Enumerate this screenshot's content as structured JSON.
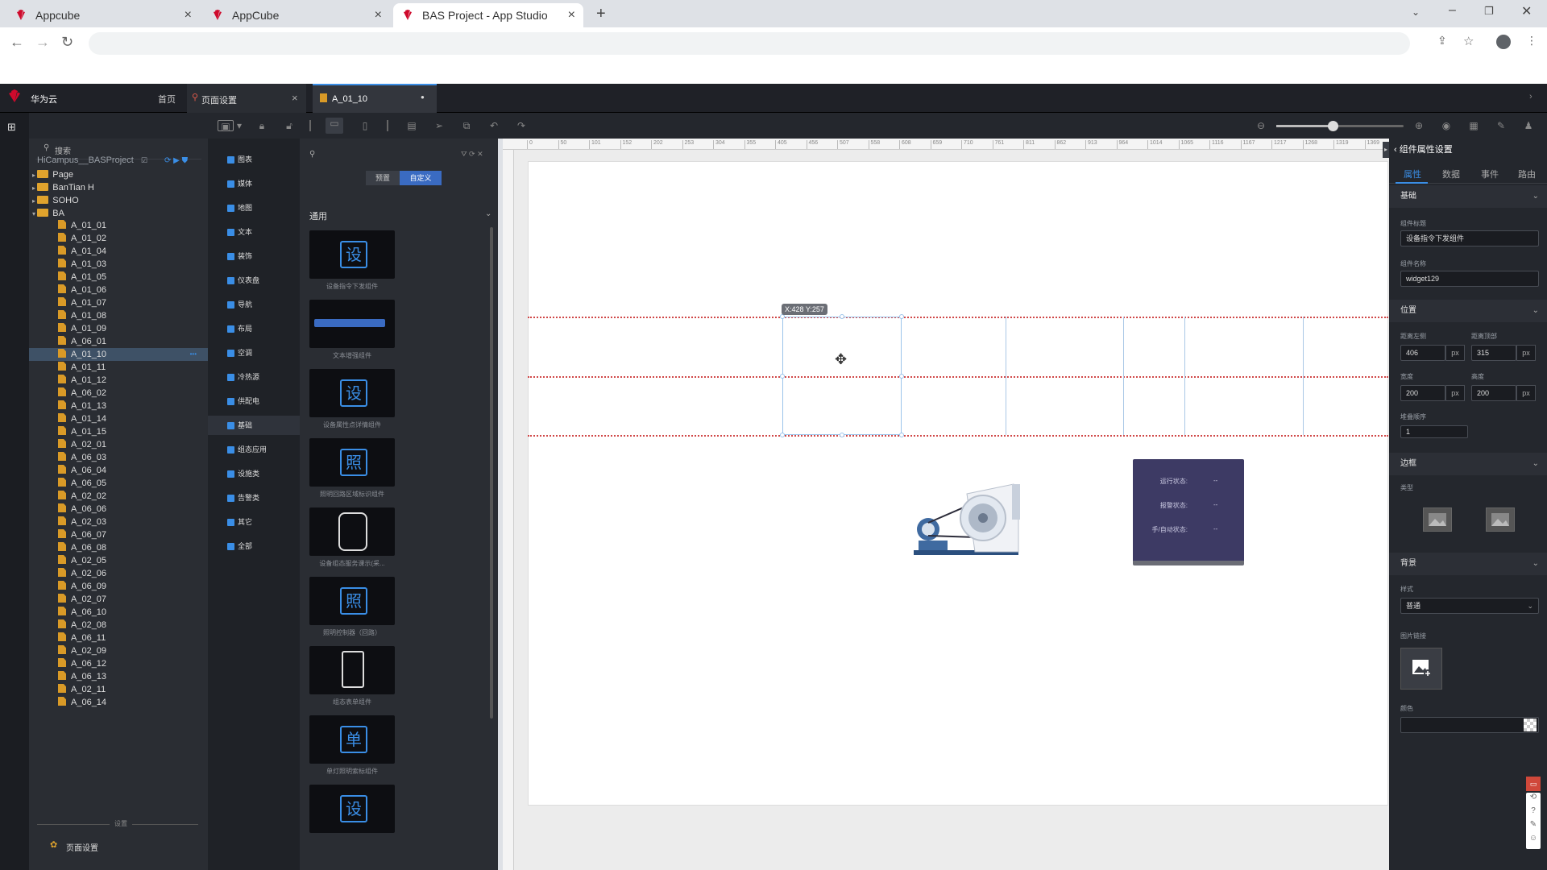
{
  "browser": {
    "tabs": [
      {
        "label": "Appcube",
        "close": "×"
      },
      {
        "label": "AppCube",
        "close": "×"
      },
      {
        "label": "BAS Project - App Studio",
        "close": "×"
      }
    ],
    "new_tab": "+"
  },
  "app": {
    "brand": "华为云",
    "home": "首页",
    "editor_tabs": [
      {
        "label": "页面设置",
        "close": "×"
      },
      {
        "label": "A_01_10",
        "close": "●"
      }
    ]
  },
  "tree": {
    "search_placeholder": "搜索",
    "project": "HiCampus__BASProject",
    "folders": [
      "Page",
      "BanTian H",
      "SOHO",
      "BA"
    ],
    "pages": [
      "A_01_01",
      "A_01_02",
      "A_01_04",
      "A_01_03",
      "A_01_05",
      "A_01_06",
      "A_01_07",
      "A_01_08",
      "A_01_09",
      "A_06_01",
      "A_01_10",
      "A_01_11",
      "A_01_12",
      "A_06_02",
      "A_01_13",
      "A_01_14",
      "A_01_15",
      "A_02_01",
      "A_06_03",
      "A_06_04",
      "A_06_05",
      "A_02_02",
      "A_06_06",
      "A_02_03",
      "A_06_07",
      "A_06_08",
      "A_02_05",
      "A_02_06",
      "A_06_09",
      "A_02_07",
      "A_06_10",
      "A_02_08",
      "A_06_11",
      "A_02_09",
      "A_06_12",
      "A_06_13",
      "A_02_11",
      "A_06_14"
    ],
    "selected": "A_01_10",
    "footer_divider": "设置",
    "footer_item": "页面设置"
  },
  "categories": {
    "items": [
      "图表",
      "媒体",
      "地图",
      "文本",
      "装饰",
      "仪表盘",
      "导航",
      "布局",
      "空调",
      "冷热源",
      "供配电",
      "基础",
      "组态应用",
      "设施类",
      "告警类",
      "其它",
      "全部"
    ],
    "selected": "基础"
  },
  "widgets": {
    "tabs": [
      "预置",
      "自定义"
    ],
    "active_tab": "自定义",
    "group": "通用",
    "items": [
      {
        "glyph": "设",
        "label": "设备指令下发组件"
      },
      {
        "glyph": "",
        "label": "文本增强组件"
      },
      {
        "glyph": "设",
        "label": "设备属性点详情组件"
      },
      {
        "glyph": "照",
        "label": "照明回路区域标识组件"
      },
      {
        "glyph": "",
        "label": "设备组态服务课示(采..."
      },
      {
        "glyph": "照",
        "label": "照明控制器（回路）"
      },
      {
        "glyph": "",
        "label": "组态表单组件"
      },
      {
        "glyph": "单",
        "label": "单灯照明索标组件"
      },
      {
        "glyph": "设",
        "label": ""
      }
    ]
  },
  "ruler": {
    "ticks": [
      "0",
      "50",
      "101",
      "152",
      "202",
      "253",
      "304",
      "355",
      "405",
      "456",
      "507",
      "558",
      "608",
      "659",
      "710",
      "761",
      "811",
      "862",
      "913",
      "964",
      "1014",
      "1065",
      "1116",
      "1167",
      "1217",
      "1268",
      "1319",
      "1369"
    ]
  },
  "canvas": {
    "coord_badge": "X:428 Y:257",
    "status": [
      {
        "label": "运行状态:",
        "value": "--"
      },
      {
        "label": "报警状态:",
        "value": "--"
      },
      {
        "label": "手/自动状态:",
        "value": "--"
      }
    ]
  },
  "props": {
    "title": "组件属性设置",
    "tabs": [
      "属性",
      "数据",
      "事件",
      "路由"
    ],
    "active_tab": "属性",
    "sections": {
      "basic": "基础",
      "position": "位置",
      "border": "边框",
      "background": "背景"
    },
    "component_title_label": "组件标题",
    "component_title": "设备指令下发组件",
    "component_name_label": "组件名称",
    "component_name": "widget129",
    "left_label": "距离左侧",
    "left": "406",
    "top_label": "距离顶部",
    "top": "315",
    "width_label": "宽度",
    "width": "200",
    "height_label": "高度",
    "height": "200",
    "unit": "px",
    "zindex_label": "堆叠顺序",
    "zindex": "1",
    "border_type_label": "类型",
    "bg_style_label": "样式",
    "bg_style": "普通",
    "bg_image_label": "图片链接",
    "color_label": "颜色"
  },
  "colors": {
    "accent": "#3a8ee6",
    "guide": "#d04848",
    "status_bg": "#3d3a64"
  }
}
